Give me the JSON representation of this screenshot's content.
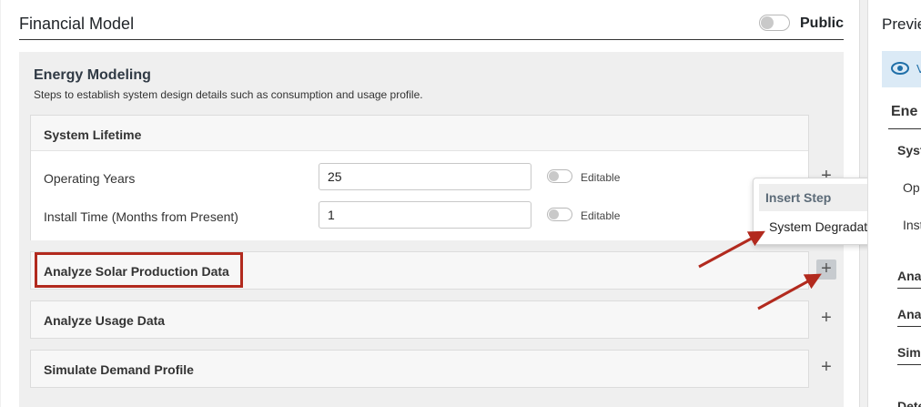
{
  "header": {
    "title": "Financial Model",
    "public_label": "Public"
  },
  "section": {
    "title": "Energy Modeling",
    "description": "Steps to establish system design details such as consumption and usage profile."
  },
  "cards": {
    "system_lifetime": {
      "title": "System Lifetime",
      "fields": [
        {
          "label": "Operating Years",
          "value": "25",
          "editable_label": "Editable"
        },
        {
          "label": "Install Time (Months from Present)",
          "value": "1",
          "editable_label": "Editable"
        }
      ]
    },
    "analyze_solar": {
      "title": "Analyze Solar Production Data"
    },
    "analyze_usage": {
      "title": "Analyze Usage Data"
    },
    "simulate_demand": {
      "title": "Simulate Demand Profile"
    }
  },
  "popup": {
    "header": "Insert Step",
    "item": "System Degradation"
  },
  "plus_glyph": "+",
  "preview": {
    "title": "Previe",
    "banner_text": "V",
    "section_label": "Ene",
    "rows": [
      "Syst",
      "Op",
      "Inst",
      "Ana",
      "Ana",
      "Simu",
      "Dete"
    ]
  },
  "colors": {
    "highlight": "#b22a1e",
    "preview_eye": "#1f6fa8"
  },
  "icons": {
    "eye": "eye-icon",
    "plus": "plus-icon"
  }
}
